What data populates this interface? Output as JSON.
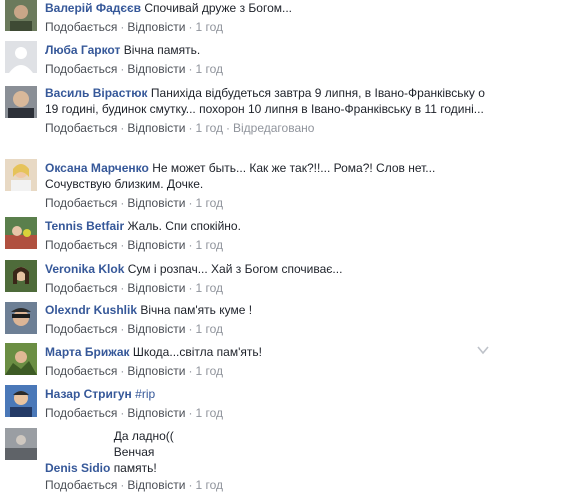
{
  "actions": {
    "like": "Подобається",
    "reply": "Відповісти",
    "sep": "·"
  },
  "comments": [
    {
      "author": "Валерій Фадєєв",
      "text": "Спочивай друже з Богом...",
      "time": "1 год"
    },
    {
      "author": "Люба Гаркот",
      "text": "Вічна память.",
      "time": "1 год"
    },
    {
      "author": "Василь Вірастюк",
      "text": "Панихіда відбудеться завтра 9 липня, в Івано-Франківську о 19 годині, будинок смутку... похорон 10 липня в Івано-Франківську в 11 годині...",
      "time": "1 год",
      "edited": "Відредаговано"
    },
    {
      "author": "Оксана Марченко",
      "text": "Не может быть... Как же так?!!... Рома?! Слов нет... Сочувствую близким. Дочке.",
      "time": "1 год"
    },
    {
      "author": "Tennis Betfair",
      "text": "Жаль. Спи спокійно.",
      "time": "1 год"
    },
    {
      "author": "Veronika Klok",
      "text": "Сум і розпач... Хай з Богом спочиває...",
      "time": "1 год"
    },
    {
      "author": "Olexndr Kushlik",
      "text": "Вічна пам'ять куме !",
      "time": "1 год"
    },
    {
      "author": "Марта Брижак",
      "text": "Шкода...світла пам'ять!",
      "time": "1 год"
    },
    {
      "author": "Назар Стригун",
      "text": "#rip",
      "time": "1 год"
    },
    {
      "author": "Denis Sidio",
      "text": "Да ладно(( Венчая память!",
      "time": "1 год"
    }
  ],
  "colors": {
    "author": "#365899",
    "action": "#4b4f56",
    "meta": "#90949c"
  },
  "icons": {
    "options": "chevron-down-icon"
  }
}
